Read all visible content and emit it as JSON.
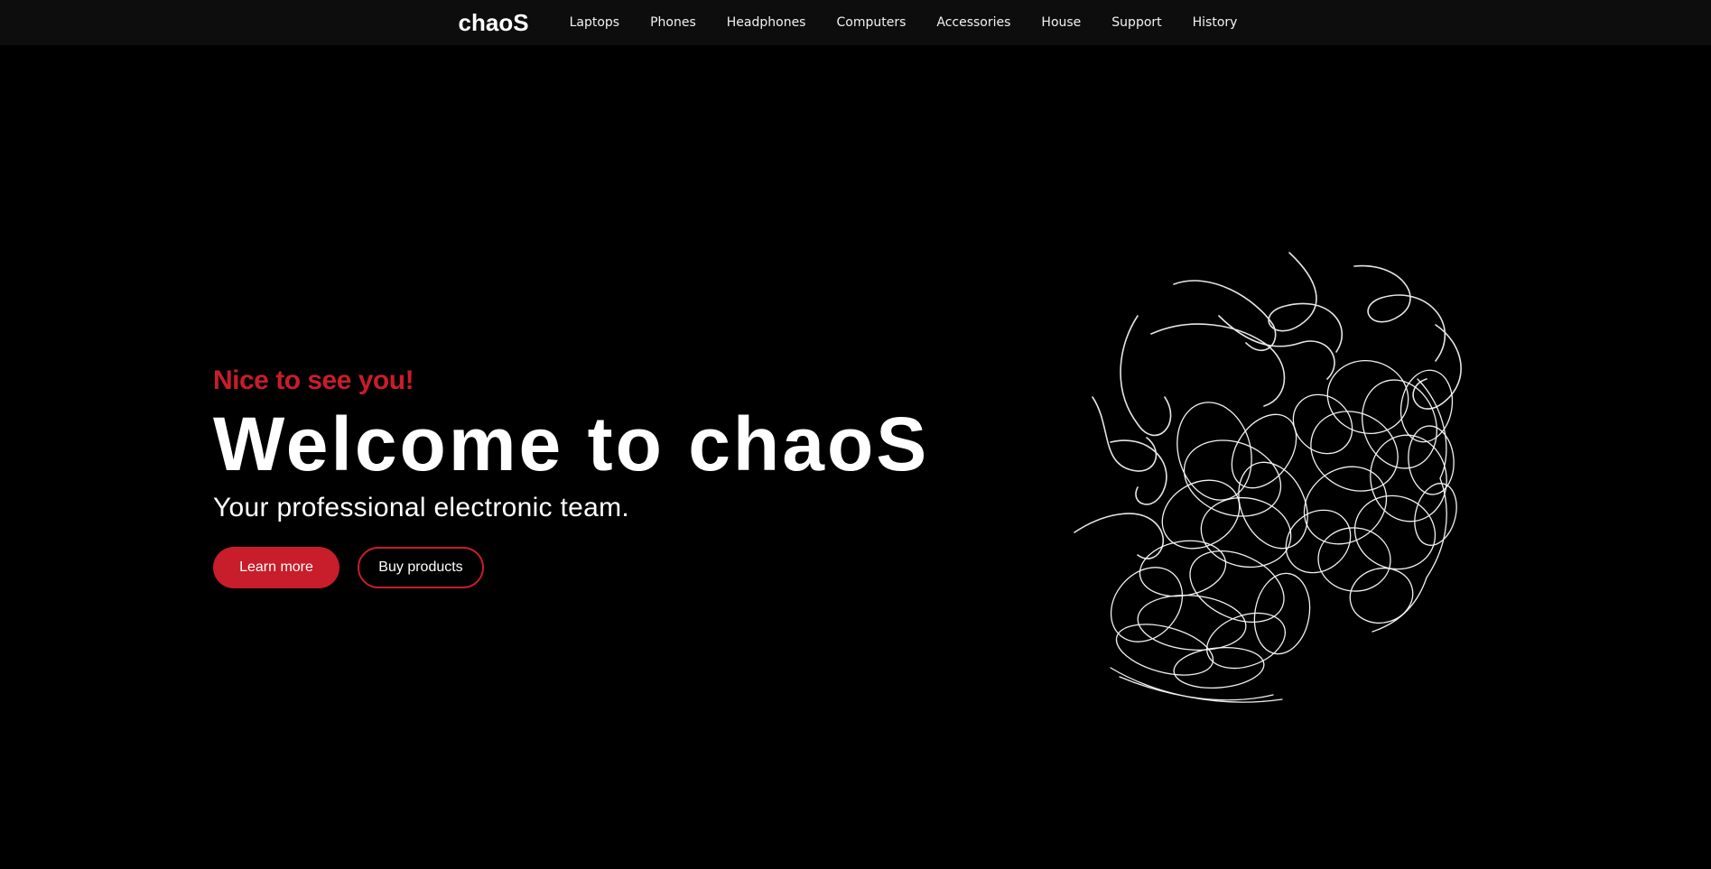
{
  "colors": {
    "background": "#000000",
    "topbar": "#0d0d0d",
    "accent": "#c81d2a",
    "text": "#ffffff"
  },
  "header": {
    "logo": "chaoS",
    "nav_items": [
      "Laptops",
      "Phones",
      "Headphones",
      "Computers",
      "Accessories",
      "House",
      "Support",
      "History"
    ]
  },
  "hero": {
    "greeting": "Nice to see you!",
    "headline": "Welcome to chaoS",
    "tagline": "Your professional electronic team.",
    "primary_button": "Learn more",
    "secondary_button": "Buy products",
    "illustration": "scribble-heads-illustration"
  }
}
